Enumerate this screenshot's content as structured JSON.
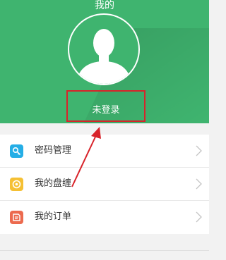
{
  "header": {
    "title": "我的",
    "login_label": "未登录",
    "avatar_icon": "user-silhouette-icon",
    "bg_color": "#3fb46f"
  },
  "menu": {
    "items": [
      {
        "label": "密码管理",
        "icon": "key-icon",
        "color": "#25aee6"
      },
      {
        "label": "我的盘缠",
        "icon": "coin-icon",
        "color": "#f5c034"
      },
      {
        "label": "我的订单",
        "icon": "order-icon",
        "color": "#ec6a4e"
      }
    ]
  },
  "annotation": {
    "color": "#d8232a"
  }
}
